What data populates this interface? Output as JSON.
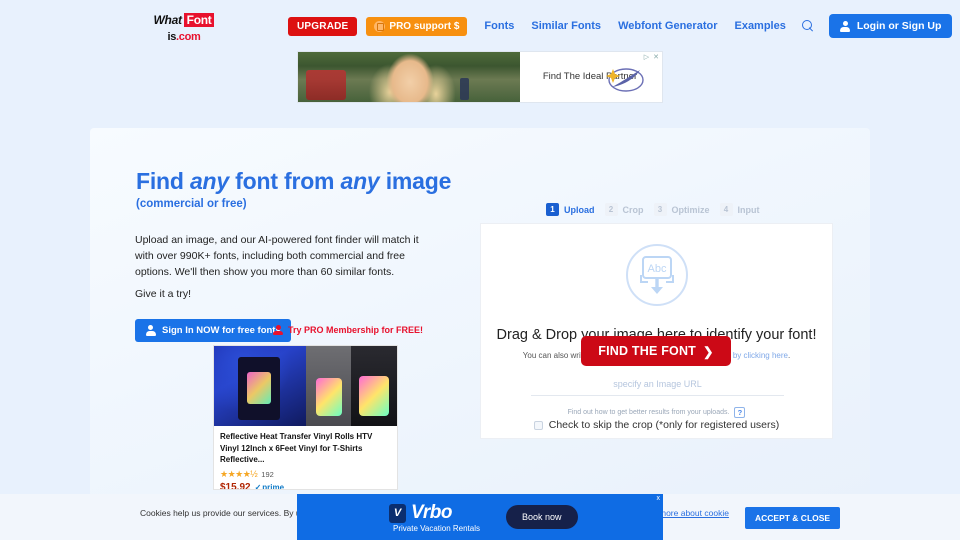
{
  "header": {
    "logo": {
      "what": "What",
      "font": "Font",
      "is": "is",
      "com": ".com"
    },
    "upgrade_label": "UPGRADE",
    "pro_label": "PRO support $",
    "nav_links": [
      "Fonts",
      "Similar Fonts",
      "Webfont Generator",
      "Examples"
    ],
    "search_icon": "search-icon",
    "login_label": "Login or Sign Up"
  },
  "top_ad": {
    "headline": "Find The Ideal Partner",
    "adchoices": "▷ ✕"
  },
  "hero": {
    "title_parts": [
      "Find ",
      "any",
      " font from ",
      "any",
      " image"
    ],
    "title_plain": "Find any font from any image",
    "subtitle": "(commercial or free)",
    "paragraph": "Upload an image, and our AI-powered font finder will match it with over 990K+ fonts, including both commercial and free options. We'll then show you more than 60 similar fonts.",
    "paragraph2": "Give it a try!",
    "signin_label": "Sign In NOW for free fonts",
    "pro_link_label": "Try PRO Membership for FREE!"
  },
  "left_ad": {
    "title": "Reflective Heat Transfer Vinyl Rolls HTV Vinyl 12Inch x 6Feet Vinyl for T-Shirts Reflective...",
    "stars": "★★★★½",
    "reviews": "192",
    "price": "$15.92",
    "prime": "prime"
  },
  "wizard": {
    "steps": [
      {
        "num": "1",
        "label": "Upload",
        "active": true
      },
      {
        "num": "2",
        "label": "Crop",
        "active": false
      },
      {
        "num": "3",
        "label": "Optimize",
        "active": false
      },
      {
        "num": "4",
        "label": "Input",
        "active": false
      }
    ]
  },
  "upload": {
    "drop_icon": "image-upload-abc-icon",
    "drop_title": "Drag & Drop your image here to identify your font!",
    "drop_sub_prefix": "You can also write a URL, copy-paste the image or ",
    "drop_sub_link": "browse by clicking here",
    "drop_sub_suffix": ".",
    "url_placeholder": "specify an Image URL",
    "url_value": "",
    "help_text": "Find out how to get better results from your uploads.",
    "help_badge": "?",
    "skip_crop_label": "Check to skip the crop (*only for registered users)",
    "skip_crop_checked": false,
    "find_button_label": "FIND THE FONT",
    "find_button_arrow": "❯"
  },
  "cookie": {
    "text": "Cookies help us provide our services. By using",
    "link": "more about cookie",
    "accept_label": "ACCEPT & CLOSE"
  },
  "bottom_ad": {
    "mark": "V",
    "brand": "Vrbo",
    "tagline": "Private Vacation Rentals",
    "cta": "Book now",
    "close": "x"
  },
  "colors": {
    "brand_blue": "#2a6fe0",
    "button_blue": "#1a73e8",
    "red": "#cc0916",
    "orange": "#f79010",
    "page_bg": "#e8f1fd"
  }
}
